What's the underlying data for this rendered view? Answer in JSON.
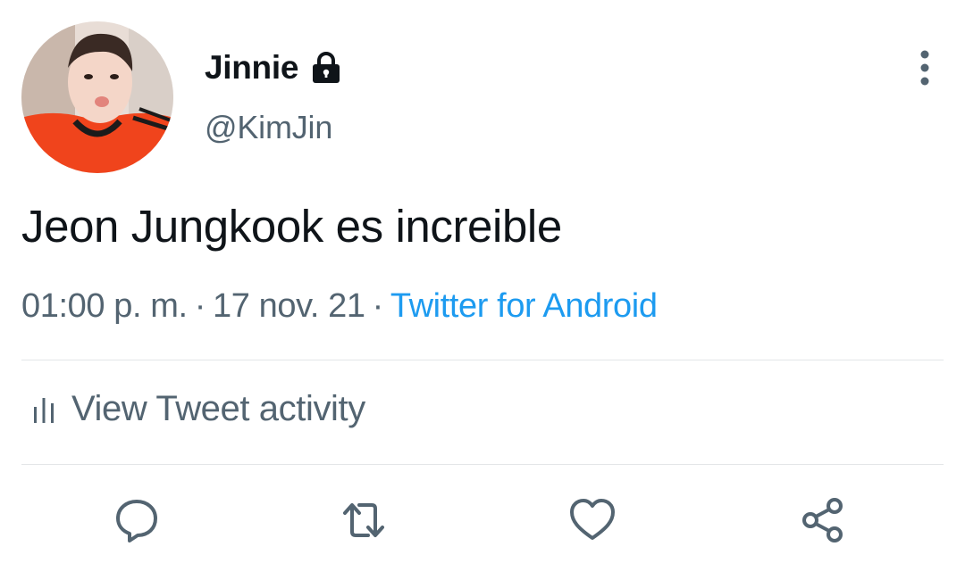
{
  "user": {
    "display_name": "Jinnie",
    "handle": "@KimJin",
    "protected": true
  },
  "tweet": {
    "text": "Jeon Jungkook es increible",
    "time": "01:00 p. m.",
    "separator": "·",
    "date": "17 nov. 21",
    "source": "Twitter for Android"
  },
  "activity": {
    "label": "View Tweet activity"
  },
  "actions": [
    "reply-icon",
    "retweet-icon",
    "like-icon",
    "share-icon"
  ],
  "colors": {
    "text": "#0f1419",
    "secondary": "#536471",
    "link": "#1d9bf0",
    "divider": "#e3e6e8"
  }
}
